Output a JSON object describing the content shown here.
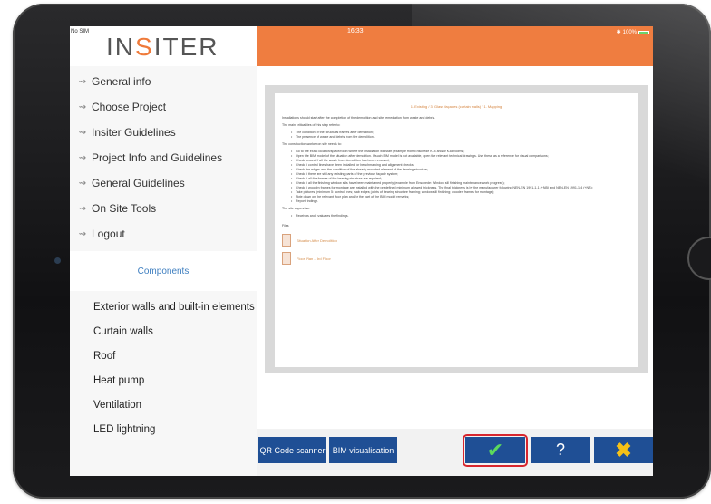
{
  "status_bar": {
    "carrier": "No SIM",
    "time": "16:33",
    "battery": "100%"
  },
  "logo": {
    "text_before": "IN",
    "text_accent": "S",
    "text_after": "ITER"
  },
  "menu": [
    {
      "label": "General info"
    },
    {
      "label": "Choose Project"
    },
    {
      "label": "Insiter Guidelines"
    },
    {
      "label": "Project Info and Guidelines"
    },
    {
      "label": "General Guidelines"
    },
    {
      "label": "On Site Tools"
    },
    {
      "label": "Logout"
    }
  ],
  "components": {
    "header": "Components",
    "items": [
      {
        "label": "Exterior walls and built-in elements"
      },
      {
        "label": "Curtain walls"
      },
      {
        "label": "Roof"
      },
      {
        "label": "Heat pump"
      },
      {
        "label": "Ventilation"
      },
      {
        "label": "LED lightning"
      }
    ]
  },
  "document": {
    "title": "1. Existing / 3. Glass façades (curtain walls) / 1. Mapping",
    "intro": "Installations should start after the completion of the demolition and site remediation from waste and debris.",
    "criticalities_label": "The main criticalities of this step refer to:",
    "criticalities": [
      "The condition of the structural frames after demolition;",
      "The presence of waste and debris from the demolition."
    ],
    "worker_label": "The construction worker on site needs to:",
    "worker_tasks": [
      "Go to the exact location/space/room where the installation will start (example from Enschede K14 and/or K38 rooms);",
      "Open the BIM model of the situation after demolition. If such BIM model is not available, open the relevant technical drawings. Use these as a reference for visual comparisons;",
      "Check around if all the waste from demolition has been removed;",
      "Check if control lines have been installed for benchmarking and alignment checks;",
      "Check the edges and the condition of the already mounted element of the bearing structure;",
      "Check if there are still any existing parts of the previous façade system;",
      "Check if all the frames of the bearing structure are repaired;",
      "Check if all the finishing window sills have been maintained properly (example from Enschede: Window sill finishing maintenance work progress);",
      "Check if wooden frames for montage are installed with the predefined minimum allowed thickness. The final thickness is by the manufacturer following NEN-EN 1991-1-1 (+NB) and NEN-EN 1991-1-4 (+NB);",
      "Take pictures (minimum 5: control lines; slab edges; joints of bearing structure framing; window sill finishing; wooden frames for montage);",
      "Note down on the relevant floor plan and/or the part of the BIM model remarks;",
      "Report findings."
    ],
    "supervisor_label": "The site supervisor:",
    "supervisor_tasks": [
      "Receives and evaluates the findings."
    ],
    "files_label": "Files",
    "files": [
      {
        "name": "Situation After Demolition"
      },
      {
        "name": "Floor Plan - 3rd Floor"
      }
    ]
  },
  "buttons": {
    "qr": "QR Code scanner",
    "bim": "BIM visualisation",
    "help": "?"
  },
  "colors": {
    "accent_orange": "#ef7d40",
    "button_blue": "#1f4f95",
    "check_green": "#5cd95c",
    "cross_yellow": "#f5c117",
    "highlight_red": "#d7262e"
  }
}
